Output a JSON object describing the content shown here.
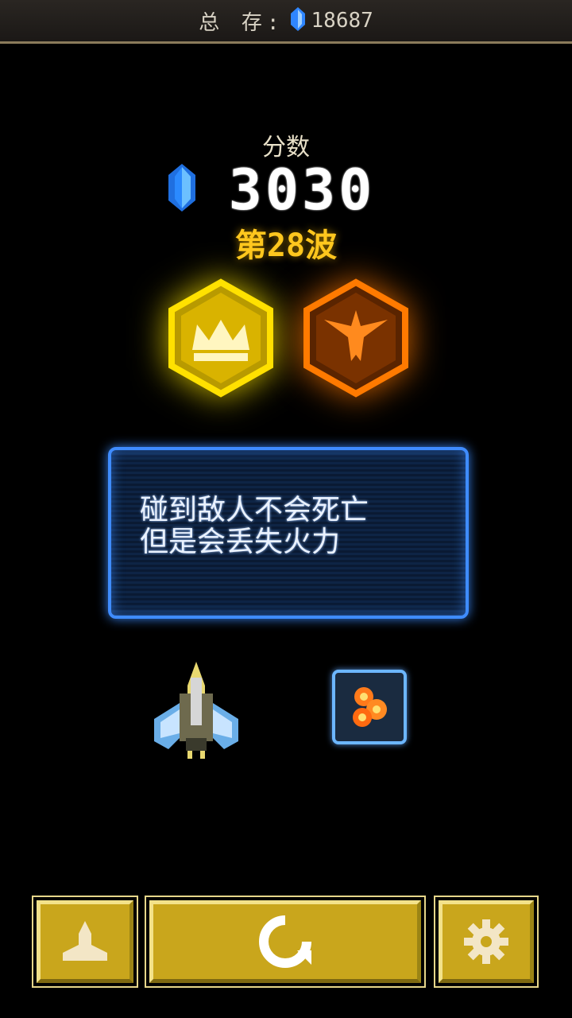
{
  "topbar": {
    "label": "总 存:",
    "gem_icon": "blue-crystal-icon",
    "gem_total": "18687"
  },
  "score": {
    "label": "分数",
    "value": "3030",
    "gem_icon": "blue-crystal-icon"
  },
  "wave": {
    "text": "第28波"
  },
  "badges": [
    {
      "icon": "crown-icon",
      "color": "#ffe100"
    },
    {
      "icon": "phoenix-icon",
      "color": "#ff7a00"
    }
  ],
  "tip": {
    "line1": "碰到敌人不会死亡",
    "line2": "但是会丢失火力"
  },
  "ship_icon": "player-ship-icon",
  "powerup_icon": "fire-powerup-icon",
  "buttons": {
    "ship": "ship-select-icon",
    "restart": "restart-icon",
    "settings": "gear-icon"
  },
  "colors": {
    "accent_gold": "#c9a61c",
    "wave_yellow": "#ffc71e",
    "tip_border": "#3f8cff"
  }
}
